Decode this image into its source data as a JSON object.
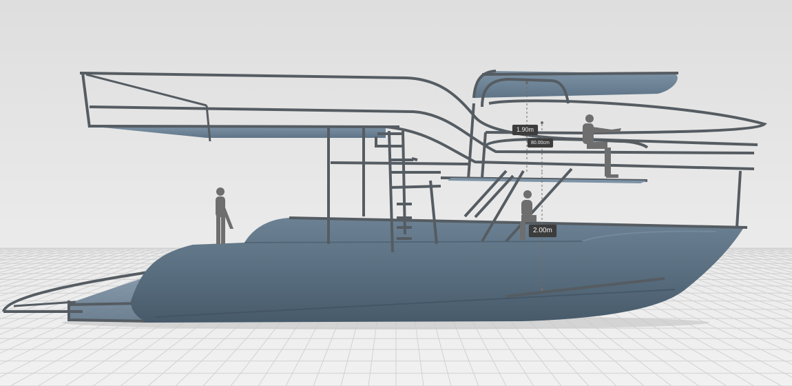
{
  "viewer": {
    "view": "side-elevation",
    "colors": {
      "background": "#e4e4e4",
      "grid": "#cfcfcf",
      "hull": "#5b6f80",
      "deck": "#6d8396",
      "rail": "#555c62",
      "figure": "#6e6e6e",
      "label_bg": "#3c3c3c",
      "label_text": "#f2f2f2"
    }
  },
  "dimensions": [
    {
      "id": "headroom",
      "text": "1.90m"
    },
    {
      "id": "rail-height",
      "text": "80.00cm"
    },
    {
      "id": "deck-height",
      "text": "2.00m"
    }
  ]
}
